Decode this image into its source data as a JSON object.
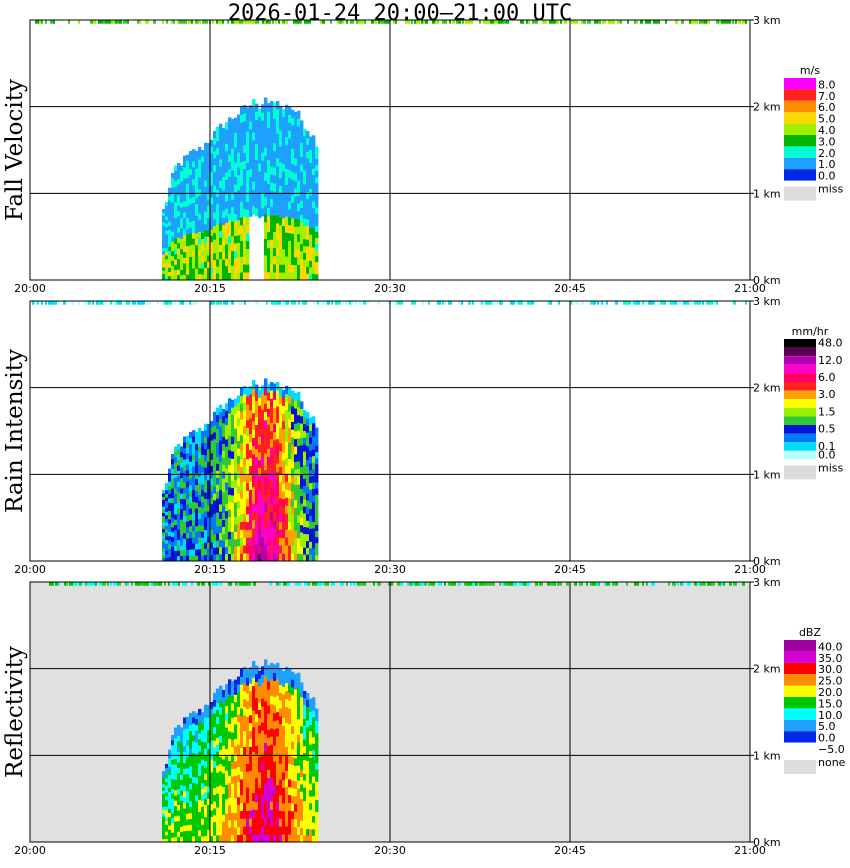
{
  "title": "2026-01-24   20:00–21:00 UTC",
  "time_ticks": [
    "20:00",
    "20:15",
    "20:30",
    "20:45",
    "21:00"
  ],
  "height_ticks": [
    "0 km",
    "1 km",
    "2 km",
    "3 km"
  ],
  "panels": [
    {
      "label": "Fall Velocity",
      "unit": "m/s",
      "legend": [
        {
          "label": "8.0",
          "color": "#ff00ff"
        },
        {
          "label": "7.0",
          "color": "#ff2020"
        },
        {
          "label": "6.0",
          "color": "#ff8c00"
        },
        {
          "label": "5.0",
          "color": "#ffd700"
        },
        {
          "label": "4.0",
          "color": "#a0f000"
        },
        {
          "label": "3.0",
          "color": "#00b400"
        },
        {
          "label": "2.0",
          "color": "#00ffd2"
        },
        {
          "label": "1.0",
          "color": "#1ea0ff"
        },
        {
          "label": "0.0",
          "color": "#0028e6"
        }
      ],
      "miss_label": "miss",
      "background": "#ffffff"
    },
    {
      "label": "Rain Intensity",
      "unit": "mm/hr",
      "legend": [
        {
          "label": "48.0",
          "color": "#000000"
        },
        {
          "label": "",
          "color": "#5a0050"
        },
        {
          "label": "12.0",
          "color": "#b400b4"
        },
        {
          "label": "",
          "color": "#ff00c8"
        },
        {
          "label": "6.0",
          "color": "#ff0064"
        },
        {
          "label": "",
          "color": "#ff2020"
        },
        {
          "label": "3.0",
          "color": "#ffa000"
        },
        {
          "label": "",
          "color": "#ffff00"
        },
        {
          "label": "1.5",
          "color": "#9bf000"
        },
        {
          "label": "",
          "color": "#32c832"
        },
        {
          "label": "0.5",
          "color": "#0014d2"
        },
        {
          "label": "",
          "color": "#0078ff"
        },
        {
          "label": "0.1",
          "color": "#00dcff"
        },
        {
          "label": "0.0",
          "color": "#b4ffff"
        }
      ],
      "miss_label": "miss",
      "background": "#ffffff"
    },
    {
      "label": "Reflectivity",
      "unit": "dBZ",
      "legend": [
        {
          "label": "40.0",
          "color": "#a000a0"
        },
        {
          "label": "35.0",
          "color": "#d200d2"
        },
        {
          "label": "30.0",
          "color": "#ff0000"
        },
        {
          "label": "25.0",
          "color": "#ff8c00"
        },
        {
          "label": "20.0",
          "color": "#ffff00"
        },
        {
          "label": "15.0",
          "color": "#00c800"
        },
        {
          "label": "10.0",
          "color": "#00ffff"
        },
        {
          "label": "5.0",
          "color": "#1ea0ff"
        },
        {
          "label": "0.0",
          "color": "#0028e6"
        },
        {
          "label": "−5.0",
          "color": "#ffffff"
        }
      ],
      "miss_label": "none",
      "background": "#e0e0e0"
    }
  ],
  "chart_data": {
    "type": "heatmap",
    "x_axis": {
      "start": "20:00",
      "end": "21:00",
      "units": "UTC"
    },
    "y_axis": {
      "range_km": [
        0,
        3
      ]
    },
    "grid": true,
    "events": {
      "precipitation_start": "20:11",
      "precipitation_end": "20:24",
      "max_echo_top_km": 2.1
    }
  }
}
